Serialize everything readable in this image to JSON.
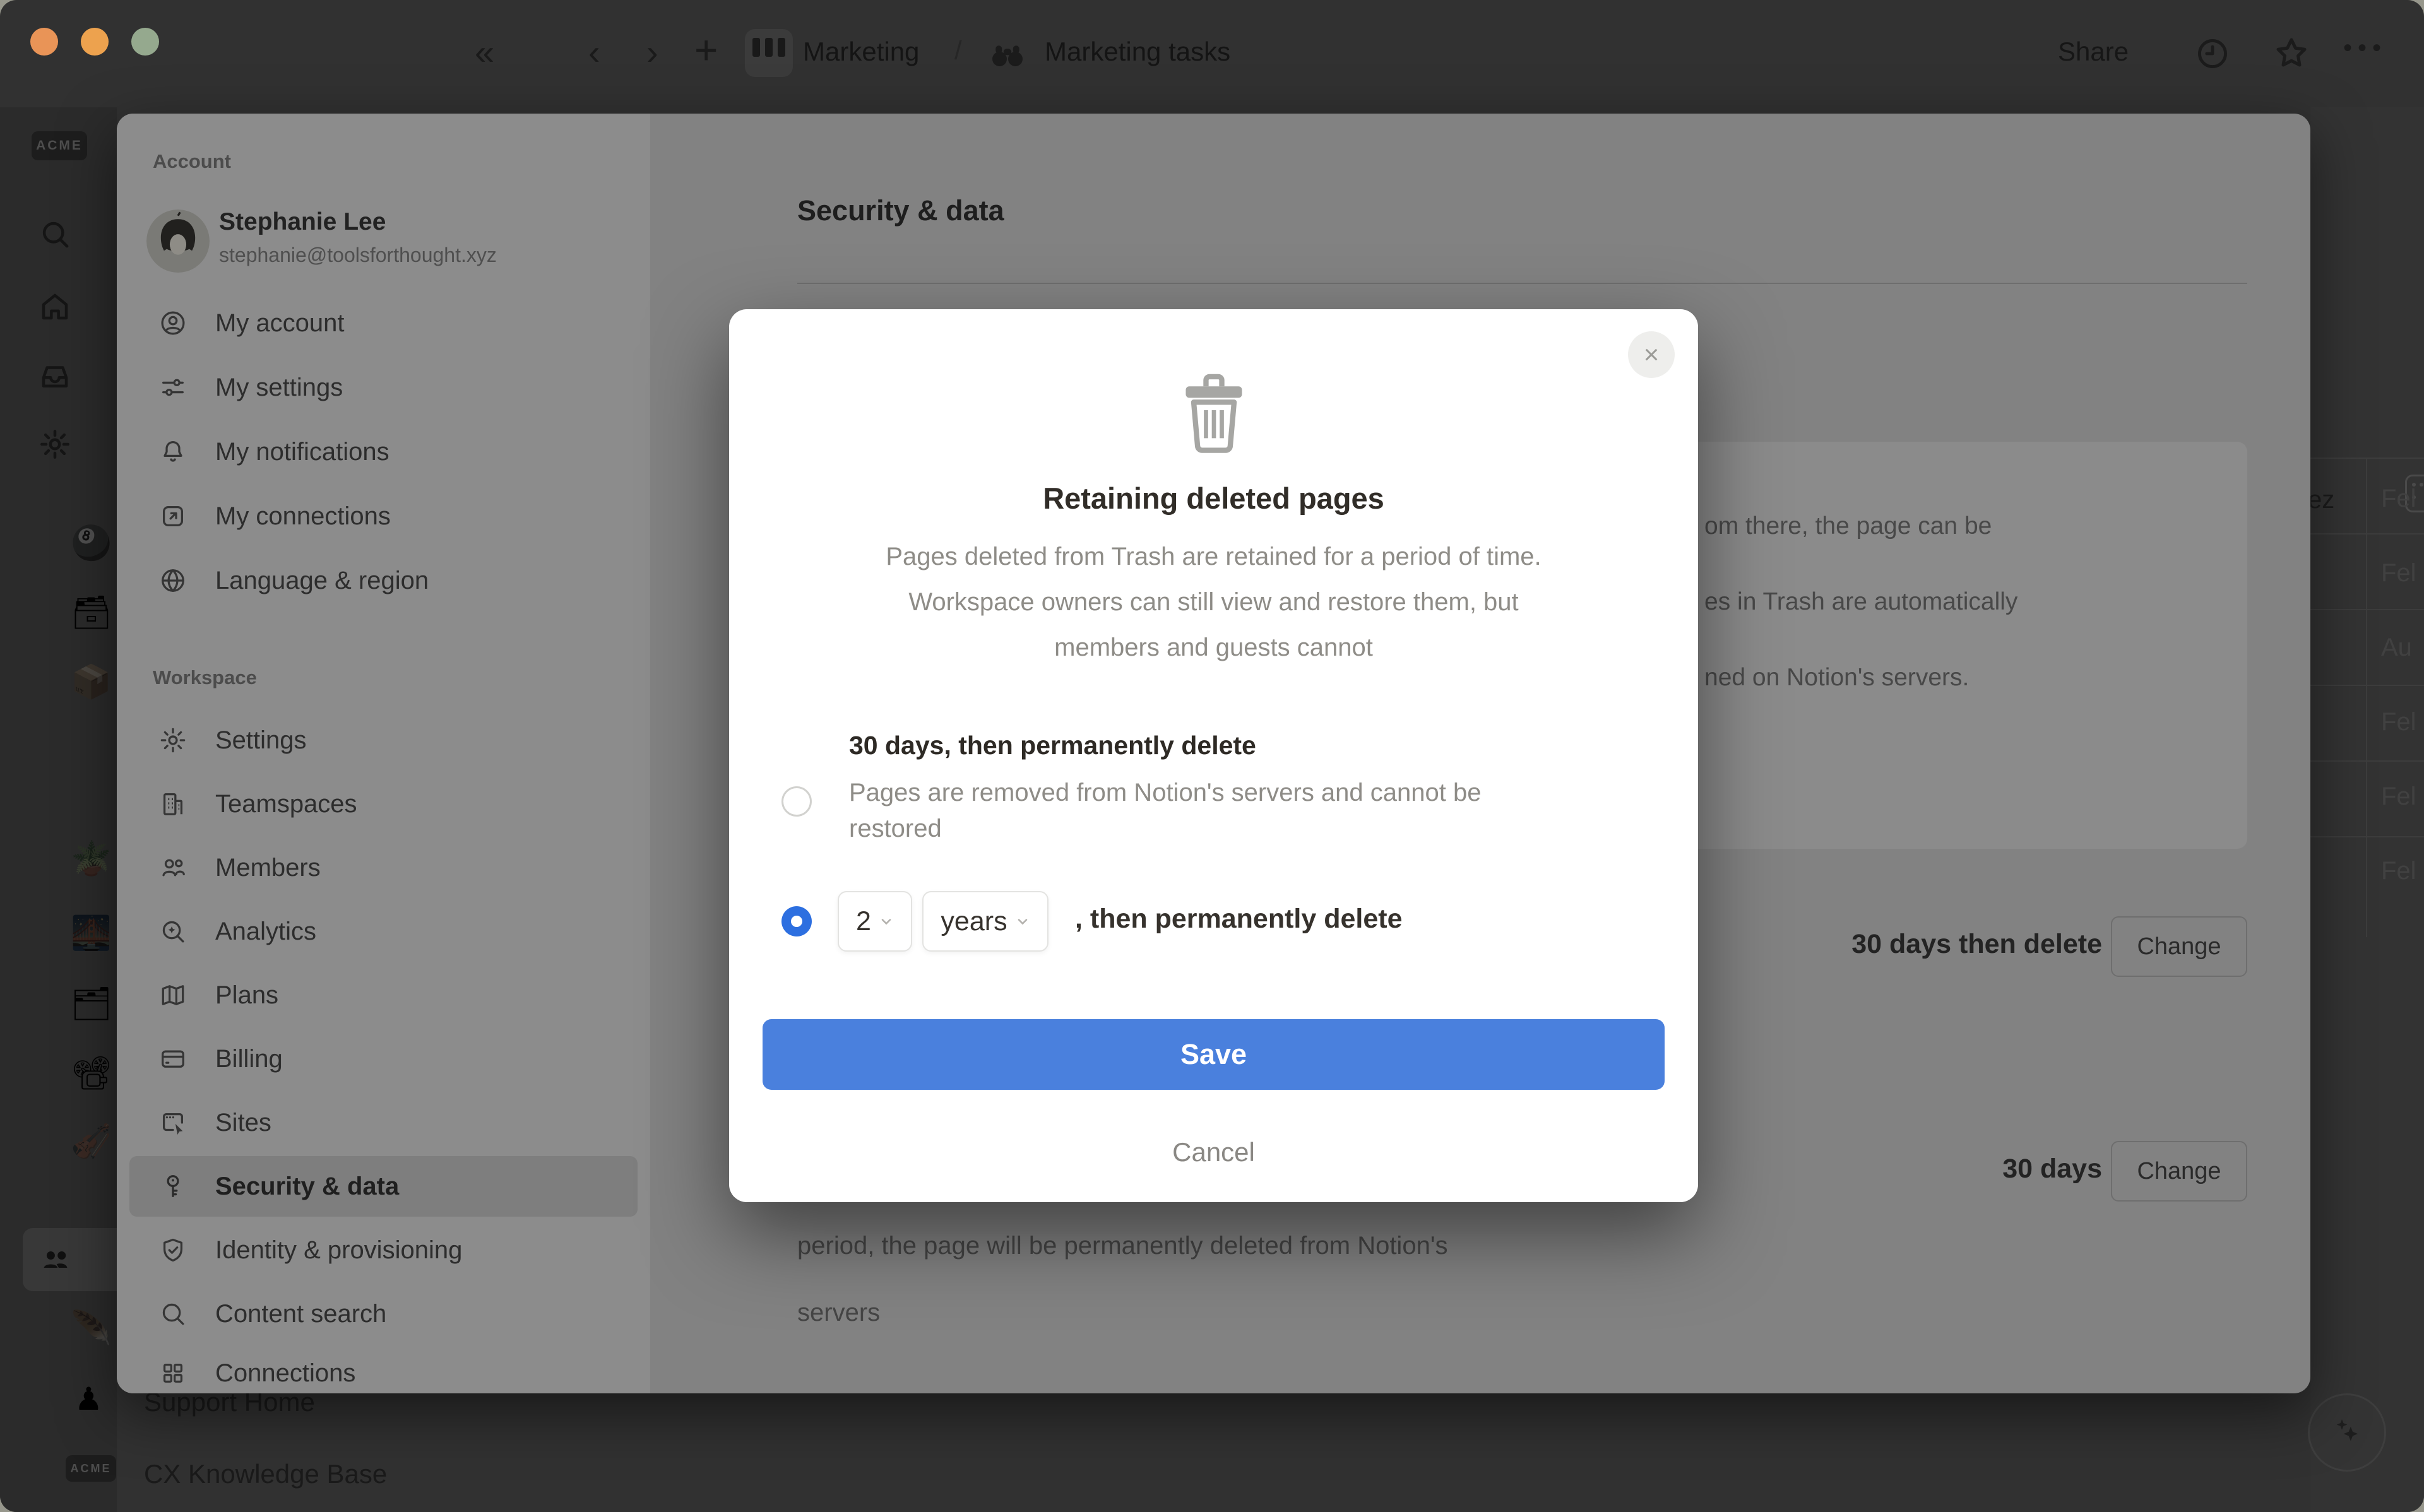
{
  "colors": {
    "accent_save": "#4a80dd",
    "radio_selected": "#2d6fe0",
    "traffic_close": "#e99457",
    "traffic_min": "#eda24e",
    "traffic_zoom": "#95a98e"
  },
  "icons": {
    "collapse": "«",
    "back": "‹",
    "forward": "›",
    "new_page": "+",
    "breadcrumb_sep": "/",
    "more": "•••",
    "close": "×",
    "pawn": "♟",
    "rail_pages": [
      "🎱",
      "🗃",
      "📦",
      "🪴",
      "🌉",
      "🗂",
      "📽",
      "🎻",
      "🪶"
    ]
  },
  "toolbar": {
    "breadcrumb_parent": "Marketing",
    "breadcrumb_current": "Marketing tasks",
    "share_label": "Share"
  },
  "app_sidebar": {
    "workspace_logo": "ACME",
    "support_home_label": "Support Home",
    "cx_kb_label": "CX Knowledge Base"
  },
  "settings": {
    "account_header": "Account",
    "user": {
      "name": "Stephanie Lee",
      "email": "stephanie@toolsforthought.xyz"
    },
    "account_items": [
      {
        "label": "My account"
      },
      {
        "label": "My settings"
      },
      {
        "label": "My notifications"
      },
      {
        "label": "My connections"
      },
      {
        "label": "Language & region"
      }
    ],
    "workspace_header": "Workspace",
    "workspace_items": [
      {
        "label": "Settings"
      },
      {
        "label": "Teamspaces"
      },
      {
        "label": "Members"
      },
      {
        "label": "Analytics"
      },
      {
        "label": "Plans"
      },
      {
        "label": "Billing"
      },
      {
        "label": "Sites"
      },
      {
        "label": "Security & data"
      },
      {
        "label": "Identity & provisioning"
      },
      {
        "label": "Content search"
      },
      {
        "label": "Connections"
      }
    ],
    "content": {
      "title": "Security & data",
      "card_fragments": [
        "om there, the page can be",
        "es in Trash are automatically",
        "ned on Notion's servers."
      ],
      "row1_value": "30 days then delete",
      "row1_action": "Change",
      "row2_value": "30 days",
      "row2_action": "Change",
      "below_line1": "period, the page will be permanently deleted from Notion's",
      "below_line2": "servers"
    }
  },
  "background_table": {
    "name_fragment": "ez",
    "cell_fragments": [
      "Fel",
      "Fel",
      "Au",
      "Fel",
      "Fel",
      "Fel"
    ]
  },
  "dialog": {
    "title": "Retaining deleted pages",
    "desc_line1": "Pages deleted from Trash are retained for a period of time.",
    "desc_line2": "Workspace owners can still view and restore them, but",
    "desc_line3": "members and guests cannot",
    "option1": {
      "label": "30 days, then permanently delete",
      "desc_line1": "Pages are removed from Notion's servers and cannot be",
      "desc_line2": "restored"
    },
    "option2": {
      "number": "2",
      "unit": "years",
      "suffix": ", then permanently delete"
    },
    "save_label": "Save",
    "cancel_label": "Cancel"
  }
}
